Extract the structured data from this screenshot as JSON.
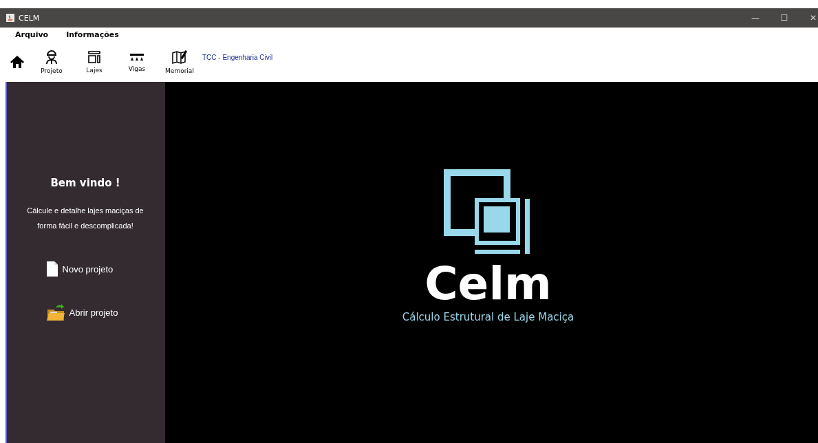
{
  "window": {
    "title": "CELM",
    "controls": [
      "—",
      "☐",
      "✕"
    ]
  },
  "menu": [
    "Arquivo",
    "Informações"
  ],
  "toolbar": {
    "items": [
      {
        "kind": "home"
      },
      {
        "kind": "worker",
        "label": "Projeto"
      },
      {
        "kind": "slab",
        "label": "Lajes"
      },
      {
        "kind": "beam",
        "label": "Vigas"
      },
      {
        "kind": "map",
        "label": "Memorial"
      }
    ],
    "caption": "TCC - Engenharia Civil"
  },
  "sidebar": {
    "title": "Bem vindo !",
    "text": "Cálcule e detalhe lajes maciças de forma fácil e descomplicada!",
    "actions": [
      {
        "kind": "file",
        "label": "Novo projeto"
      },
      {
        "kind": "folder",
        "label": "Abrir projeto"
      }
    ]
  },
  "splash": {
    "name": "Celm",
    "subtitle": "Cálculo Estrutural de Laje Maciça"
  }
}
